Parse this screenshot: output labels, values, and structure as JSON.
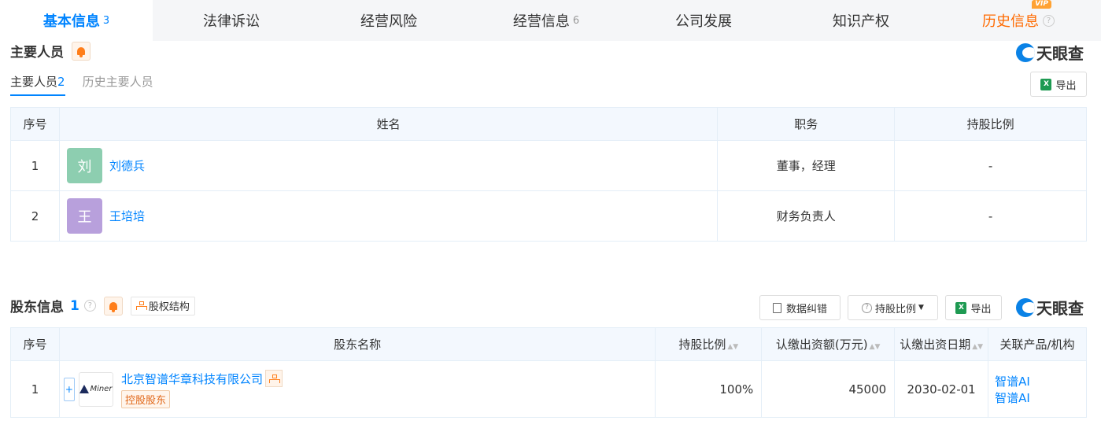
{
  "tabs": [
    {
      "label": "基本信息",
      "count": "3"
    },
    {
      "label": "法律诉讼",
      "count": ""
    },
    {
      "label": "经营风险",
      "count": ""
    },
    {
      "label": "经营信息",
      "count": "6"
    },
    {
      "label": "公司发展",
      "count": ""
    },
    {
      "label": "知识产权",
      "count": ""
    },
    {
      "label": "历史信息",
      "count": "",
      "badge": "VIP"
    }
  ],
  "brand": "天眼查",
  "people": {
    "title": "主要人员",
    "subtabs": [
      {
        "label": "主要人员",
        "count": "2"
      },
      {
        "label": "历史主要人员",
        "count": ""
      }
    ],
    "export_label": "导出",
    "columns": [
      "序号",
      "姓名",
      "职务",
      "持股比例"
    ],
    "rows": [
      {
        "idx": "1",
        "avatar": "刘",
        "avatar_color": "#8dceb0",
        "name": "刘德兵",
        "role": "董事，经理",
        "share": "-"
      },
      {
        "idx": "2",
        "avatar": "王",
        "avatar_color": "#b8a0dc",
        "name": "王培培",
        "role": "财务负责人",
        "share": "-"
      }
    ]
  },
  "shareholders": {
    "title": "股东信息",
    "count": "1",
    "structure_label": "股权结构",
    "correct_label": "数据纠错",
    "ratio_label": "持股比例",
    "export_label": "导出",
    "columns": [
      "序号",
      "股东名称",
      "持股比例",
      "认缴出资额(万元)",
      "认缴出资日期",
      "关联产品/机构"
    ],
    "rows": [
      {
        "idx": "1",
        "logo": "Miner",
        "name": "北京智谱华章科技有限公司",
        "tag": "控股股东",
        "ratio": "100%",
        "amount": "45000",
        "date": "2030-02-01",
        "products": [
          "智谱AI",
          "智谱AI"
        ]
      }
    ]
  }
}
